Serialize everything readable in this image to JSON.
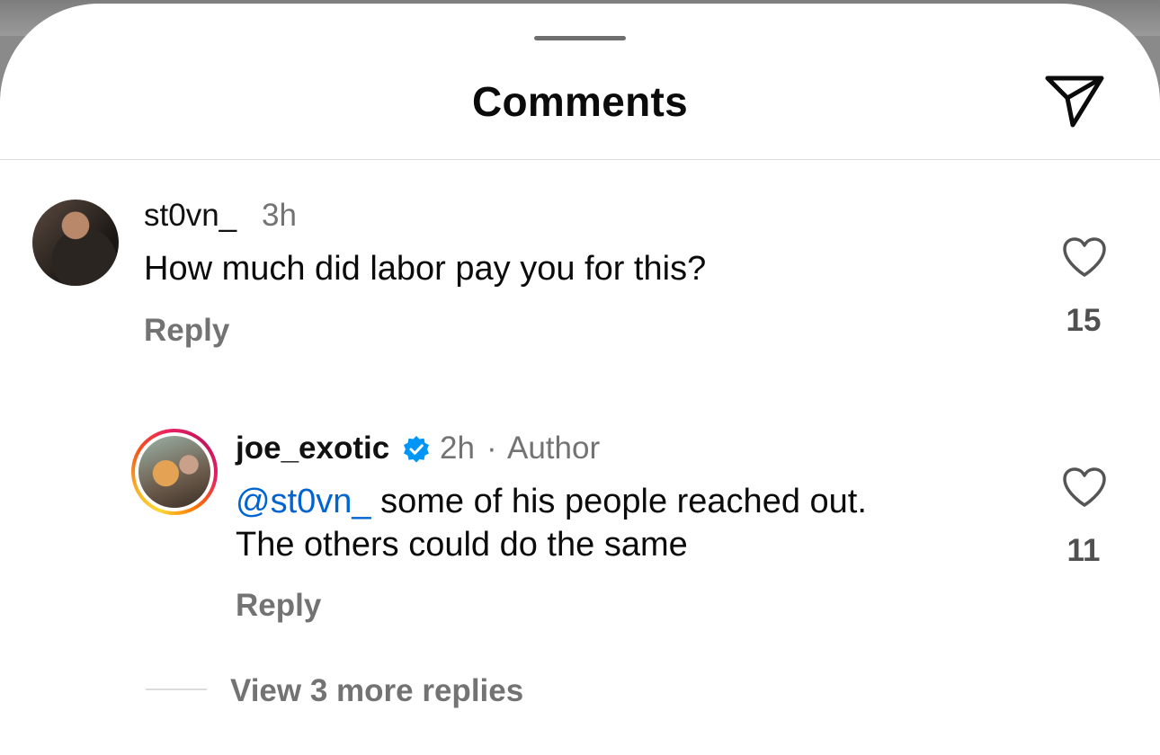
{
  "header": {
    "title": "Comments",
    "send_icon": "paper-plane-icon"
  },
  "comments": [
    {
      "username": "st0vn_",
      "time": "3h",
      "text": "How much did labor pay you for this?",
      "reply_label": "Reply",
      "likes": "15"
    }
  ],
  "replies": [
    {
      "username": "joe_exotic",
      "verified": true,
      "time": "2h",
      "separator": "·",
      "role": "Author",
      "mention": "@st0vn_",
      "text_line1": " some of his people reached out.",
      "text_line2": "The others could do the same",
      "reply_label": "Reply",
      "likes": "11"
    }
  ],
  "view_more": "View 3 more replies",
  "colors": {
    "mention": "#0064d1",
    "verified": "#0095f6",
    "meta": "#737373"
  }
}
